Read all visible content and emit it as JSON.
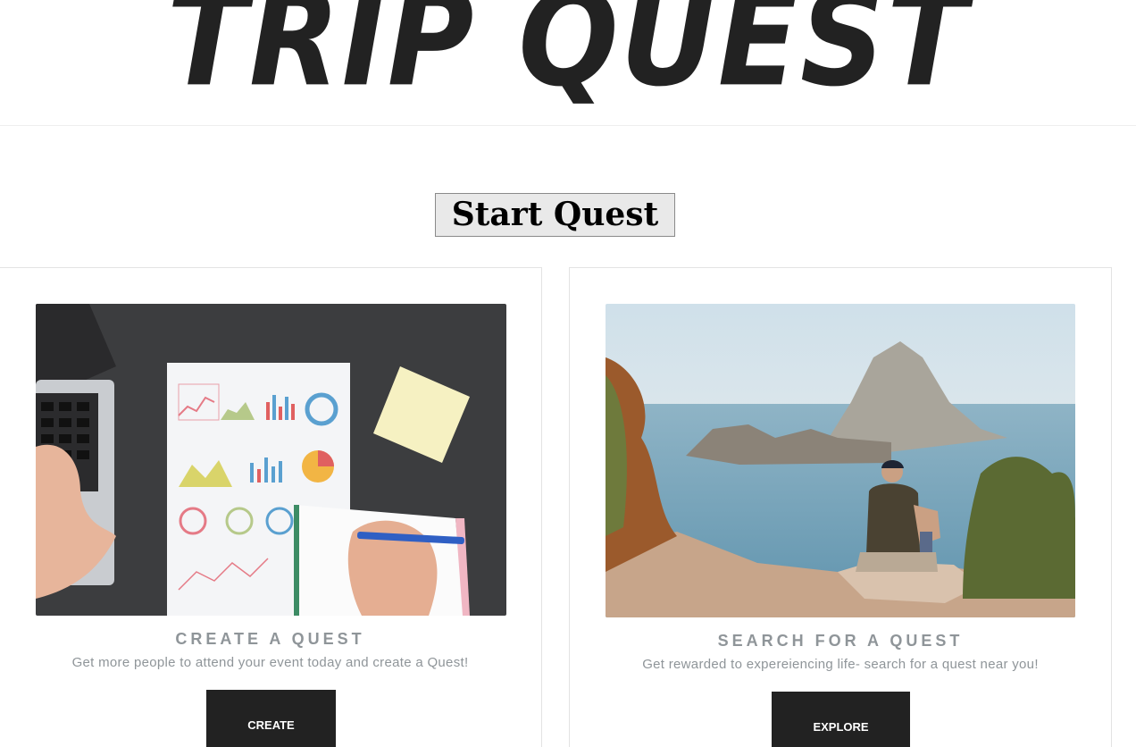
{
  "header": {
    "brand": "TRIP QUEST"
  },
  "hero": {
    "start_button_label": "Start Quest"
  },
  "cards": {
    "create": {
      "image": "laptop-charts-notebook-photo",
      "title": "CREATE A QUEST",
      "description": "Get more people to attend your event today and create a Quest!",
      "button_label": "CREATE"
    },
    "search": {
      "image": "coastal-island-hiker-photo",
      "title": "SEARCH FOR A QUEST",
      "description": "Get rewarded to expereiencing life- search for a quest near you!",
      "button_label": "EXPLORE"
    }
  },
  "colors": {
    "brand_text": "#222222",
    "muted_text": "#8f9599",
    "button_dark": "#222222",
    "card_border": "#e3e3e3"
  }
}
